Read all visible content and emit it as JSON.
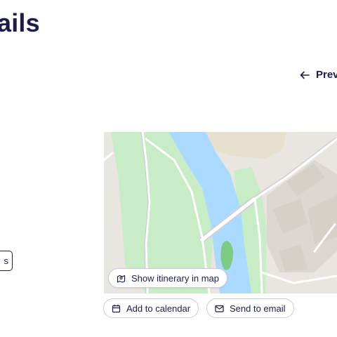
{
  "header": {
    "title": "ails",
    "prev_label": "Prev"
  },
  "left_panel": {
    "button_label": "s"
  },
  "map": {
    "itinerary_label": "Show itinerary in map"
  },
  "actions": {
    "calendar_label": "Add to calendar",
    "email_label": "Send to email"
  },
  "icons": {
    "prev": "arrow-left-icon",
    "itinerary": "map-icon",
    "calendar": "calendar-icon",
    "email": "mail-icon"
  },
  "colors": {
    "text": "#1b1e4b",
    "water": "#aadaff",
    "park": "#c8ecc6",
    "land": "#e9e6e1",
    "building": "#d9d5cd",
    "urban": "#e7e0cf"
  }
}
